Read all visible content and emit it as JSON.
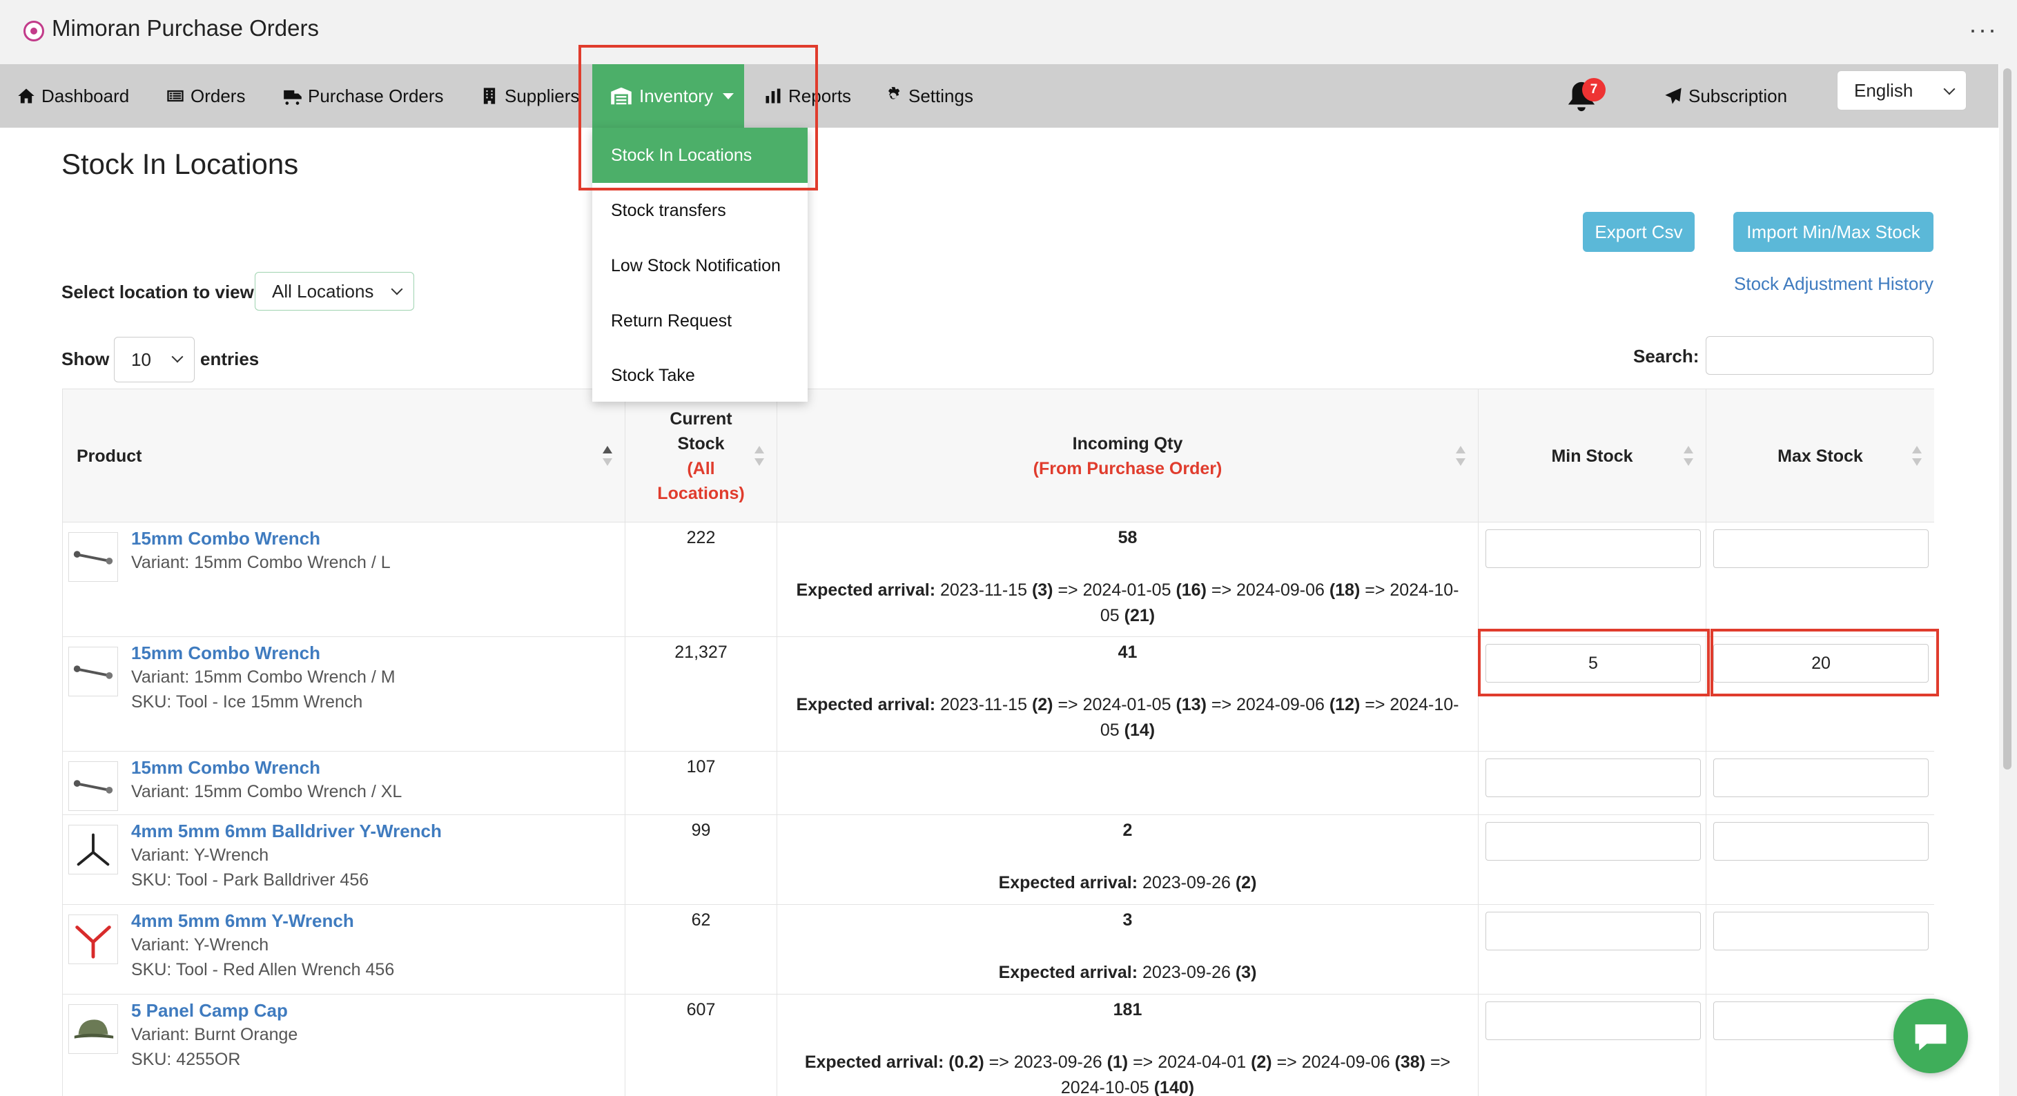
{
  "app": {
    "title": "Mimoran Purchase Orders",
    "more": "···"
  },
  "nav": {
    "dashboard": "Dashboard",
    "orders": "Orders",
    "purchase_orders": "Purchase Orders",
    "suppliers": "Suppliers",
    "inventory": "Inventory",
    "reports": "Reports",
    "settings": "Settings",
    "notification_count": "7",
    "subscription": "Subscription",
    "language": "English"
  },
  "inventory_menu": {
    "items": [
      "Stock In Locations",
      "Stock transfers",
      "Low Stock Notification",
      "Return Request",
      "Stock Take"
    ],
    "active_index": 0
  },
  "page": {
    "title": "Stock In Locations",
    "export_csv": "Export Csv",
    "import_minmax": "Import Min/Max Stock",
    "adjustment_history": "Stock Adjustment History",
    "location_label": "Select location to view",
    "location_value": "All Locations",
    "show_label": "Show",
    "show_value": "10",
    "entries_label": "entries",
    "search_label": "Search:"
  },
  "table": {
    "headers": {
      "product": "Product",
      "current_stock": "Current Stock",
      "current_stock_note": "(All Locations)",
      "incoming_qty": "Incoming Qty",
      "incoming_note": "(From Purchase Order)",
      "min_stock": "Min Stock",
      "max_stock": "Max Stock"
    },
    "arrival_label": "Expected arrival:",
    "rows": [
      {
        "name": "15mm Combo Wrench",
        "variant": "Variant: 15mm Combo Wrench / L",
        "sku": "",
        "stock": "222",
        "incoming": "58",
        "arrival": [
          [
            "2023-11-15",
            "3"
          ],
          [
            "2024-01-05",
            "16"
          ],
          [
            "2024-09-06",
            "18"
          ],
          [
            "2024-10-05",
            "21"
          ]
        ],
        "min": "",
        "max": "",
        "thumb": "wrench-icon"
      },
      {
        "name": "15mm Combo Wrench",
        "variant": "Variant: 15mm Combo Wrench / M",
        "sku": "SKU: Tool - Ice 15mm Wrench",
        "stock": "21,327",
        "incoming": "41",
        "arrival": [
          [
            "2023-11-15",
            "2"
          ],
          [
            "2024-01-05",
            "13"
          ],
          [
            "2024-09-06",
            "12"
          ],
          [
            "2024-10-05",
            "14"
          ]
        ],
        "min": "5",
        "max": "20",
        "thumb": "wrench-icon"
      },
      {
        "name": "15mm Combo Wrench",
        "variant": "Variant: 15mm Combo Wrench / XL",
        "sku": "",
        "stock": "107",
        "incoming": "",
        "arrival": [],
        "min": "",
        "max": "",
        "thumb": "wrench-icon"
      },
      {
        "name": "4mm 5mm 6mm Balldriver Y-Wrench",
        "variant": "Variant: Y-Wrench",
        "sku": "SKU: Tool - Park Balldriver 456",
        "stock": "99",
        "incoming": "2",
        "arrival": [
          [
            "2023-09-26",
            "2"
          ]
        ],
        "min": "",
        "max": "",
        "thumb": "y-wrench-black-icon"
      },
      {
        "name": "4mm 5mm 6mm Y-Wrench",
        "variant": "Variant: Y-Wrench",
        "sku": "SKU: Tool - Red Allen Wrench 456",
        "stock": "62",
        "incoming": "3",
        "arrival": [
          [
            "2023-09-26",
            "3"
          ]
        ],
        "min": "",
        "max": "",
        "thumb": "y-wrench-red-icon"
      },
      {
        "name": "5 Panel Camp Cap",
        "variant": "Variant: Burnt Orange",
        "sku": "SKU: 4255OR",
        "stock": "607",
        "incoming": "181",
        "arrival_lead": "(0.2)",
        "arrival": [
          [
            "2023-09-26",
            "1"
          ],
          [
            "2024-04-01",
            "2"
          ],
          [
            "2024-09-06",
            "38"
          ],
          [
            "2024-10-05",
            "140"
          ]
        ],
        "min": "",
        "max": "",
        "thumb": "cap-icon"
      }
    ]
  },
  "colors": {
    "accent": "#4caf69",
    "link": "#3f7bbf",
    "button": "#5bb8d8",
    "highlight": "#e03c2d"
  }
}
